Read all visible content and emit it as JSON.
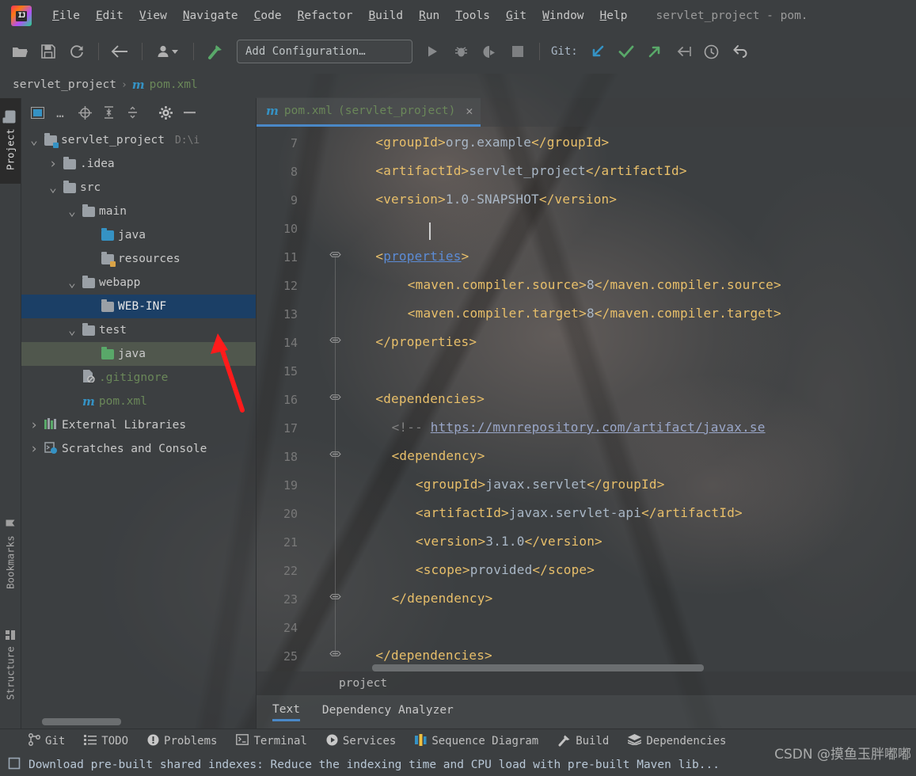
{
  "window": {
    "title": "servlet_project - pom."
  },
  "menubar": {
    "logo": "intellij-idea-logo",
    "items": [
      {
        "label": "File",
        "mnemonic": "F"
      },
      {
        "label": "Edit",
        "mnemonic": "E"
      },
      {
        "label": "View",
        "mnemonic": "V"
      },
      {
        "label": "Navigate",
        "mnemonic": "N"
      },
      {
        "label": "Code",
        "mnemonic": "C"
      },
      {
        "label": "Refactor",
        "mnemonic": "R"
      },
      {
        "label": "Build",
        "mnemonic": "B"
      },
      {
        "label": "Run",
        "mnemonic": "R"
      },
      {
        "label": "Tools",
        "mnemonic": "T"
      },
      {
        "label": "Git",
        "mnemonic": "G"
      },
      {
        "label": "Window",
        "mnemonic": "W"
      },
      {
        "label": "Help",
        "mnemonic": "H"
      }
    ]
  },
  "toolbar": {
    "open_icon": "folder-open-icon",
    "save_icon": "save-icon",
    "sync_icon": "refresh-icon",
    "back_icon": "arrow-left-icon",
    "profile_icon": "user-dropdown-icon",
    "build_icon": "hammer-icon",
    "run_config_label": "Add Configuration…",
    "run_icon": "run-icon",
    "debug_icon": "debug-icon",
    "coverage_icon": "run-with-coverage-icon",
    "stop_icon": "stop-icon",
    "git_label": "Git:",
    "git_update_icon": "update-project-icon",
    "git_commit_icon": "commit-checkmark-icon",
    "git_push_icon": "push-arrow-icon",
    "git_rebase_icon": "rebase-icon",
    "git_history_icon": "history-clock-icon",
    "git_rollback_icon": "rollback-icon"
  },
  "breadcrumb": {
    "project": "servlet_project",
    "separator": "›",
    "file_icon": "maven-m-icon",
    "file": "pom.xml"
  },
  "left_rail": {
    "project_tab": "Project",
    "project_icon": "folder-icon",
    "bookmarks_tab": "Bookmarks",
    "bookmarks_icon": "bookmark-icon",
    "structure_tab": "Structure",
    "structure_icon": "structure-grid-icon"
  },
  "project_panel": {
    "toolbar": {
      "expand_icon": "window-mode-icon",
      "more_icon": "ellipsis-icon",
      "locate_icon": "scroll-from-source-icon",
      "expand_all_icon": "expand-all-icon",
      "collapse_all_icon": "collapse-all-icon",
      "settings_icon": "gear-icon",
      "hide_icon": "minimize-icon"
    },
    "tree": [
      {
        "label": "servlet_project",
        "path": "D:\\i",
        "depth": 0,
        "arrow": "expanded",
        "icon": "module-folder",
        "state": "normal"
      },
      {
        "label": ".idea",
        "path": "",
        "depth": 1,
        "arrow": "collapsed",
        "icon": "folder",
        "state": "normal"
      },
      {
        "label": "src",
        "path": "",
        "depth": 1,
        "arrow": "expanded",
        "icon": "folder",
        "state": "normal"
      },
      {
        "label": "main",
        "path": "",
        "depth": 2,
        "arrow": "expanded",
        "icon": "folder",
        "state": "normal"
      },
      {
        "label": "java",
        "path": "",
        "depth": 3,
        "arrow": "none",
        "icon": "source-folder",
        "state": "normal"
      },
      {
        "label": "resources",
        "path": "",
        "depth": 3,
        "arrow": "none",
        "icon": "resource-folder",
        "state": "normal"
      },
      {
        "label": "webapp",
        "path": "",
        "depth": 2,
        "arrow": "expanded",
        "icon": "folder",
        "state": "normal"
      },
      {
        "label": "WEB-INF",
        "path": "",
        "depth": 3,
        "arrow": "none",
        "icon": "folder",
        "state": "selected"
      },
      {
        "label": "test",
        "path": "",
        "depth": 2,
        "arrow": "expanded",
        "icon": "folder",
        "state": "normal"
      },
      {
        "label": "java",
        "path": "",
        "depth": 3,
        "arrow": "none",
        "icon": "test-source-folder",
        "state": "highlighted"
      },
      {
        "label": ".gitignore",
        "path": "",
        "depth": 2,
        "arrow": "none",
        "icon": "gitignore-file",
        "state": "green"
      },
      {
        "label": "pom.xml",
        "path": "",
        "depth": 2,
        "arrow": "none",
        "icon": "maven-m-icon",
        "state": "green"
      },
      {
        "label": "External Libraries",
        "path": "",
        "depth": 0,
        "arrow": "collapsed",
        "icon": "libraries-icon",
        "state": "normal"
      },
      {
        "label": "Scratches and Console",
        "path": "",
        "depth": 0,
        "arrow": "collapsed",
        "icon": "scratches-icon",
        "state": "normal"
      }
    ]
  },
  "editor": {
    "tab": {
      "icon": "maven-m-icon",
      "name": "pom.xml",
      "module": "(servlet_project)",
      "close_icon": "close-icon"
    },
    "first_line_number": 7,
    "lines": [
      {
        "n": 7,
        "indent": 4,
        "fold": false,
        "segments": [
          {
            "t": "tag",
            "s": "<groupId>"
          },
          {
            "t": "val",
            "s": "org.example"
          },
          {
            "t": "tag",
            "s": "</groupId>"
          }
        ]
      },
      {
        "n": 8,
        "indent": 4,
        "fold": false,
        "segments": [
          {
            "t": "tag",
            "s": "<artifactId>"
          },
          {
            "t": "val",
            "s": "servlet_project"
          },
          {
            "t": "tag",
            "s": "</artifactId>"
          }
        ]
      },
      {
        "n": 9,
        "indent": 4,
        "fold": false,
        "segments": [
          {
            "t": "tag",
            "s": "<version>"
          },
          {
            "t": "val",
            "s": "1.0-SNAPSHOT"
          },
          {
            "t": "tag",
            "s": "</version>"
          }
        ]
      },
      {
        "n": 10,
        "indent": 0,
        "fold": false,
        "caret": true,
        "segments": []
      },
      {
        "n": 11,
        "indent": 4,
        "fold": true,
        "segments": [
          {
            "t": "tag",
            "s": "<"
          },
          {
            "t": "ul",
            "s": "properties"
          },
          {
            "t": "tag",
            "s": ">"
          }
        ]
      },
      {
        "n": 12,
        "indent": 8,
        "fold": false,
        "segments": [
          {
            "t": "tag",
            "s": "<maven.compiler.source>"
          },
          {
            "t": "val",
            "s": "8"
          },
          {
            "t": "tag",
            "s": "</maven.compiler.source>"
          }
        ]
      },
      {
        "n": 13,
        "indent": 8,
        "fold": false,
        "segments": [
          {
            "t": "tag",
            "s": "<maven.compiler.target>"
          },
          {
            "t": "val",
            "s": "8"
          },
          {
            "t": "tag",
            "s": "</maven.compiler.target>"
          }
        ]
      },
      {
        "n": 14,
        "indent": 4,
        "fold": true,
        "segments": [
          {
            "t": "tag",
            "s": "</properties>"
          }
        ]
      },
      {
        "n": 15,
        "indent": 0,
        "fold": false,
        "segments": []
      },
      {
        "n": 16,
        "indent": 4,
        "fold": true,
        "segments": [
          {
            "t": "tag",
            "s": "<dependencies>"
          }
        ]
      },
      {
        "n": 17,
        "indent": 6,
        "fold": false,
        "segments": [
          {
            "t": "cmt",
            "s": "<!-- "
          },
          {
            "t": "lnk",
            "s": "https://mvnrepository.com/artifact/javax.se"
          }
        ]
      },
      {
        "n": 18,
        "indent": 6,
        "fold": true,
        "segments": [
          {
            "t": "tag",
            "s": "<dependency>"
          }
        ]
      },
      {
        "n": 19,
        "indent": 9,
        "fold": false,
        "segments": [
          {
            "t": "tag",
            "s": "<groupId>"
          },
          {
            "t": "val",
            "s": "javax.servlet"
          },
          {
            "t": "tag",
            "s": "</groupId>"
          }
        ]
      },
      {
        "n": 20,
        "indent": 9,
        "fold": false,
        "segments": [
          {
            "t": "tag",
            "s": "<artifactId>"
          },
          {
            "t": "val",
            "s": "javax.servlet-api"
          },
          {
            "t": "tag",
            "s": "</artifactId>"
          }
        ]
      },
      {
        "n": 21,
        "indent": 9,
        "fold": false,
        "segments": [
          {
            "t": "tag",
            "s": "<version>"
          },
          {
            "t": "val",
            "s": "3.1.0"
          },
          {
            "t": "tag",
            "s": "</version>"
          }
        ]
      },
      {
        "n": 22,
        "indent": 9,
        "fold": false,
        "segments": [
          {
            "t": "tag",
            "s": "<scope>"
          },
          {
            "t": "val",
            "s": "provided"
          },
          {
            "t": "tag",
            "s": "</scope>"
          }
        ]
      },
      {
        "n": 23,
        "indent": 6,
        "fold": true,
        "segments": [
          {
            "t": "tag",
            "s": "</dependency>"
          }
        ]
      },
      {
        "n": 24,
        "indent": 0,
        "fold": false,
        "segments": []
      },
      {
        "n": 25,
        "indent": 4,
        "fold": true,
        "segments": [
          {
            "t": "tag",
            "s": "</dependencies>"
          }
        ]
      }
    ],
    "crumb": "project",
    "bottom_tabs": [
      {
        "label": "Text",
        "active": true
      },
      {
        "label": "Dependency Analyzer",
        "active": false
      }
    ]
  },
  "tool_windows": [
    {
      "label": "Git",
      "icon": "git-branch-icon"
    },
    {
      "label": "TODO",
      "icon": "todo-list-icon"
    },
    {
      "label": "Problems",
      "icon": "problems-icon"
    },
    {
      "label": "Terminal",
      "icon": "terminal-icon"
    },
    {
      "label": "Services",
      "icon": "services-icon"
    },
    {
      "label": "Sequence Diagram",
      "icon": "sequence-diagram-icon"
    },
    {
      "label": "Build",
      "icon": "hammer-icon"
    },
    {
      "label": "Dependencies",
      "icon": "dependencies-layers-icon"
    }
  ],
  "statusbar": {
    "icon": "notification-icon",
    "message": "Download pre-built shared indexes: Reduce the indexing time and CPU load with pre-built Maven lib..."
  },
  "watermark": "CSDN @摸鱼玉胖嘟嘟",
  "colors": {
    "accent_blue": "#4a88c7",
    "tag_orange": "#e8bf6a",
    "value_blue": "#a9b7c6",
    "green_text": "#6a8759",
    "selection_blue": "#1b3f66",
    "panel_bg": "#3c3f41",
    "annotation_red": "#ff1b1b"
  }
}
